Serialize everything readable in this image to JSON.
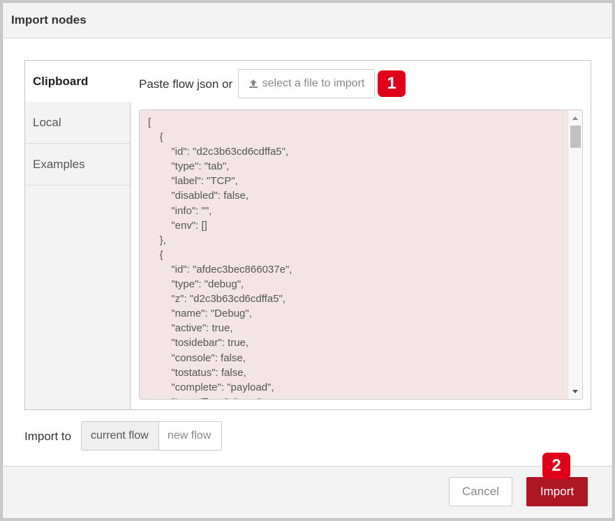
{
  "dialog": {
    "title": "Import nodes"
  },
  "tabs": [
    {
      "label": "Clipboard",
      "active": true
    },
    {
      "label": "Local",
      "active": false
    },
    {
      "label": "Examples",
      "active": false
    }
  ],
  "clipboard": {
    "paste_label": "Paste flow json or",
    "file_button_label": "select a file to import",
    "file_button_icon": "upload-icon",
    "json_lines": [
      "[",
      "    {",
      "        \"id\": \"d2c3b63cd6cdffa5\",",
      "        \"type\": \"tab\",",
      "        \"label\": \"TCP\",",
      "        \"disabled\": false,",
      "        \"info\": \"\",",
      "        \"env\": []",
      "    },",
      "    {",
      "        \"id\": \"afdec3bec866037e\",",
      "        \"type\": \"debug\",",
      "        \"z\": \"d2c3b63cd6cdffa5\",",
      "        \"name\": \"Debug\",",
      "        \"active\": true,",
      "        \"tosidebar\": true,",
      "        \"console\": false,",
      "        \"tostatus\": false,",
      "        \"complete\": \"payload\",",
      "        \"targetType\": \"msg\","
    ]
  },
  "import_to": {
    "label": "Import to",
    "options": [
      "current flow",
      "new flow"
    ],
    "selected": "current flow"
  },
  "footer": {
    "cancel_label": "Cancel",
    "import_label": "Import"
  },
  "annotations": {
    "badge_1": "1",
    "badge_2": "2"
  },
  "colors": {
    "badge": "#e1001a",
    "import_button": "#ad1625",
    "json_background": "#f3e5e5"
  }
}
